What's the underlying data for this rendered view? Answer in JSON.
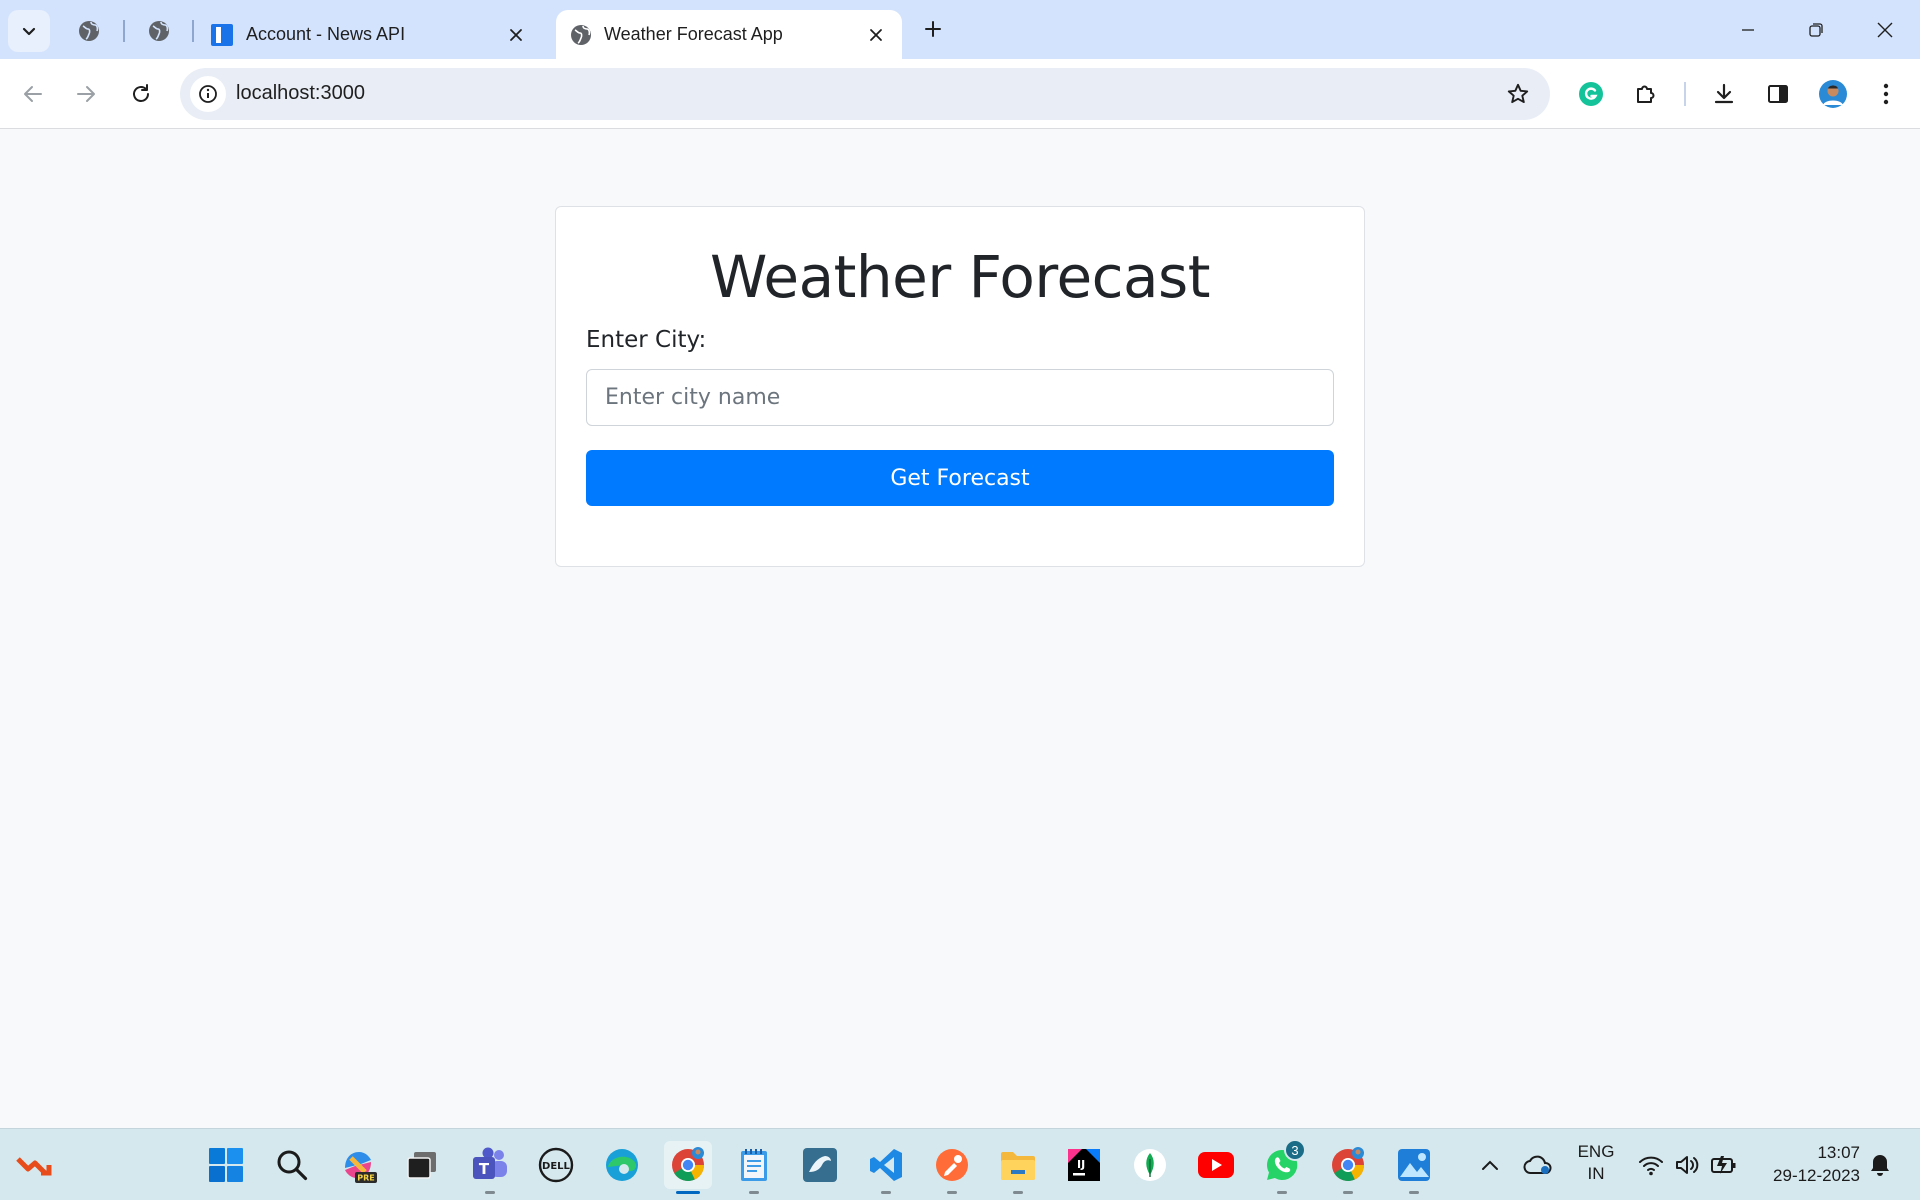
{
  "browser": {
    "tabs": [
      {
        "title": "Account - News API",
        "active": false
      },
      {
        "title": "Weather Forecast App",
        "active": true
      }
    ],
    "url": "localhost:3000"
  },
  "page": {
    "heading": "Weather Forecast",
    "city_label": "Enter City:",
    "city_input": {
      "value": "",
      "placeholder": "Enter city name"
    },
    "button_label": "Get Forecast"
  },
  "taskbar": {
    "whatsapp_badge": "3",
    "language_line1": "ENG",
    "language_line2": "IN",
    "time": "13:07",
    "date": "29-12-2023"
  },
  "colors": {
    "primary_button": "#007bff",
    "tabstrip": "#d3e3fd",
    "page_background": "#f8f9fa"
  }
}
